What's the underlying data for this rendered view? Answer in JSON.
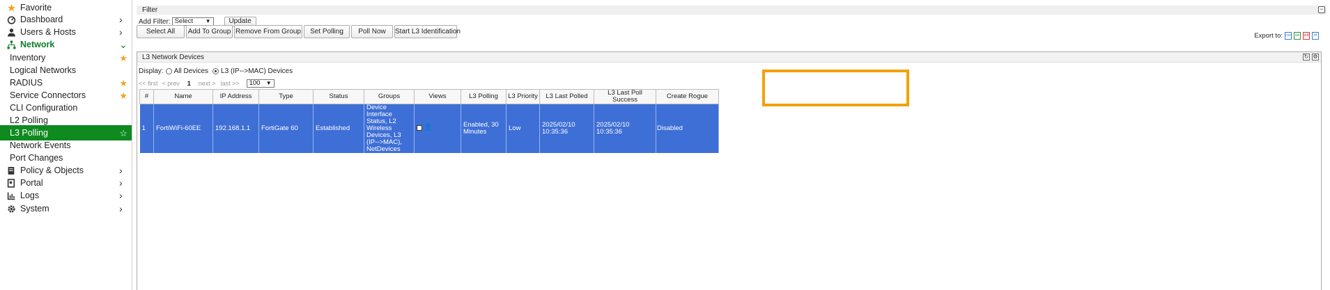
{
  "sidebar": {
    "items": [
      {
        "label": "Favorite",
        "icon": "star-icon",
        "chevron": false,
        "star": false
      },
      {
        "label": "Dashboard",
        "icon": "dashboard-icon",
        "chevron": true
      },
      {
        "label": "Users & Hosts",
        "icon": "user-icon",
        "chevron": true
      },
      {
        "label": "Network",
        "icon": "network-icon",
        "chevron": true,
        "open": true
      },
      {
        "label": "Inventory",
        "sub": true,
        "star": "filled"
      },
      {
        "label": "Logical Networks",
        "sub": true
      },
      {
        "label": "RADIUS",
        "sub": true,
        "star": "filled"
      },
      {
        "label": "Service Connectors",
        "sub": true,
        "star": "filled"
      },
      {
        "label": "CLI Configuration",
        "sub": true
      },
      {
        "label": "L2 Polling",
        "sub": true
      },
      {
        "label": "L3 Polling",
        "sub": true,
        "star": "outline",
        "active": true
      },
      {
        "label": "Network Events",
        "sub": true
      },
      {
        "label": "Port Changes",
        "sub": true
      },
      {
        "label": "Policy & Objects",
        "icon": "policy-icon",
        "chevron": true
      },
      {
        "label": "Portal",
        "icon": "portal-icon",
        "chevron": true
      },
      {
        "label": "Logs",
        "icon": "logs-icon",
        "chevron": true
      },
      {
        "label": "System",
        "icon": "gear-icon",
        "chevron": true
      }
    ]
  },
  "filter": {
    "title": "Filter",
    "add_filter_label": "Add Filter:",
    "select_value": "Select",
    "update_label": "Update"
  },
  "toolbar": {
    "select_all": "Select All",
    "add_to_group": "Add To Group",
    "remove_from_group": "Remove From Group",
    "set_polling": "Set Polling",
    "poll_now": "Poll Now",
    "start_l3": "Start L3 Identification"
  },
  "export": {
    "label": "Export to:",
    "formats": [
      "csv",
      "xls",
      "pdf",
      "rtf"
    ]
  },
  "panel": {
    "title": "L3 Network Devices",
    "display_label": "Display:",
    "option_all": "All Devices",
    "option_l3": "L3 (IP-->MAC) Devices"
  },
  "pager": {
    "first": "<< first",
    "prev": "< prev",
    "page": "1",
    "next": "next >",
    "last": "last >>",
    "page_size": "100"
  },
  "table": {
    "columns": [
      "#",
      "Name",
      "IP Address",
      "Type",
      "Status",
      "Groups",
      "Views",
      "L3 Polling",
      "L3 Priority",
      "L3 Last Polled",
      "L3 Last Poll Success",
      "Create Rogue"
    ],
    "rows": [
      {
        "num": "1",
        "name": "FortiWiFi-60EE",
        "ip": "192.168.1.1",
        "type": "FortiGate 60",
        "status": "Established",
        "groups": "Device Interface Status, L2 Wireless Devices, L3 (IP-->MAC), NetDevices",
        "l3_polling": "Enabled, 30 Minutes",
        "l3_priority": "Low",
        "l3_last_polled": "2025/02/10 10:35:36",
        "l3_last_poll_success": "2025/02/10 10:35:36",
        "create_rogue": "Disabled"
      }
    ]
  },
  "colors": {
    "accent_green": "#0e8a1f",
    "row_selected": "#3e6fd6",
    "highlight": "#f2a20c",
    "star": "#f0a525"
  }
}
